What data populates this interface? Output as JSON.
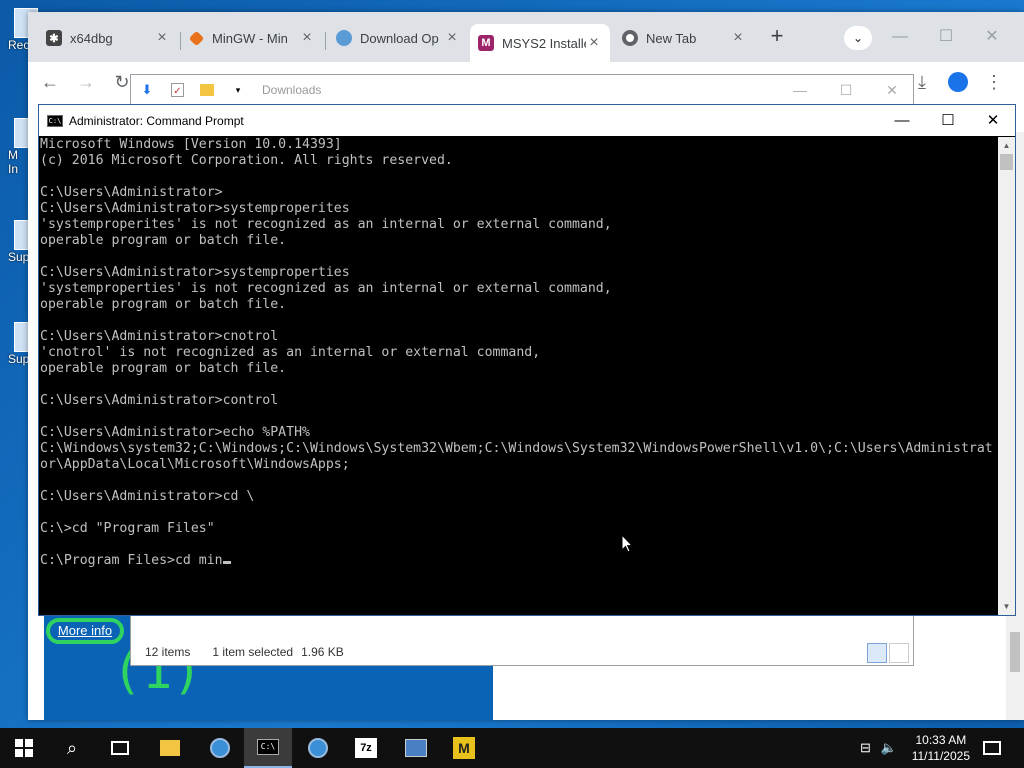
{
  "desktop": {
    "icons": [
      {
        "label": "Rec"
      },
      {
        "label": "M"
      },
      {
        "label": "In"
      },
      {
        "label": "Sup"
      },
      {
        "label": "Sup"
      }
    ]
  },
  "browser": {
    "tabs": [
      {
        "label": "x64dbg",
        "icon": "bug-icon",
        "active": false
      },
      {
        "label": "MinGW - Min",
        "icon": "diamond-icon",
        "active": false
      },
      {
        "label": "Download Op",
        "icon": "globe-icon",
        "active": false
      },
      {
        "label": "MSYS2 Installe",
        "icon": "msys2-icon",
        "active": true
      },
      {
        "label": "New Tab",
        "icon": "chrome-icon",
        "active": false
      }
    ],
    "page": {
      "more_info": "More info",
      "big_text": "(1)"
    }
  },
  "explorer": {
    "title": "Downloads",
    "status": {
      "items": "12 items",
      "selected": "1 item selected",
      "size": "1.96 KB"
    }
  },
  "cmd": {
    "title": "Administrator: Command Prompt",
    "lines": [
      "Microsoft Windows [Version 10.0.14393]",
      "(c) 2016 Microsoft Corporation. All rights reserved.",
      "",
      "C:\\Users\\Administrator>",
      "C:\\Users\\Administrator>systemproperites",
      "'systemproperites' is not recognized as an internal or external command,",
      "operable program or batch file.",
      "",
      "C:\\Users\\Administrator>systemproperties",
      "'systemproperties' is not recognized as an internal or external command,",
      "operable program or batch file.",
      "",
      "C:\\Users\\Administrator>cnotrol",
      "'cnotrol' is not recognized as an internal or external command,",
      "operable program or batch file.",
      "",
      "C:\\Users\\Administrator>control",
      "",
      "C:\\Users\\Administrator>echo %PATH%",
      "C:\\Windows\\system32;C:\\Windows;C:\\Windows\\System32\\Wbem;C:\\Windows\\System32\\WindowsPowerShell\\v1.0\\;C:\\Users\\Administrat",
      "or\\AppData\\Local\\Microsoft\\WindowsApps;",
      "",
      "C:\\Users\\Administrator>cd \\",
      "",
      "C:\\>cd \"Program Files\"",
      "",
      "C:\\Program Files>cd min"
    ]
  },
  "taskbar": {
    "clock": {
      "time": "10:33 AM",
      "date": "11/11/2025"
    }
  },
  "colors": {
    "cmd_bg": "#000000",
    "cmd_fg": "#c0c0c0",
    "taskbar_bg": "#101010",
    "desktop_bg": "#0b5aa8",
    "accent_green": "#2fd35f"
  }
}
